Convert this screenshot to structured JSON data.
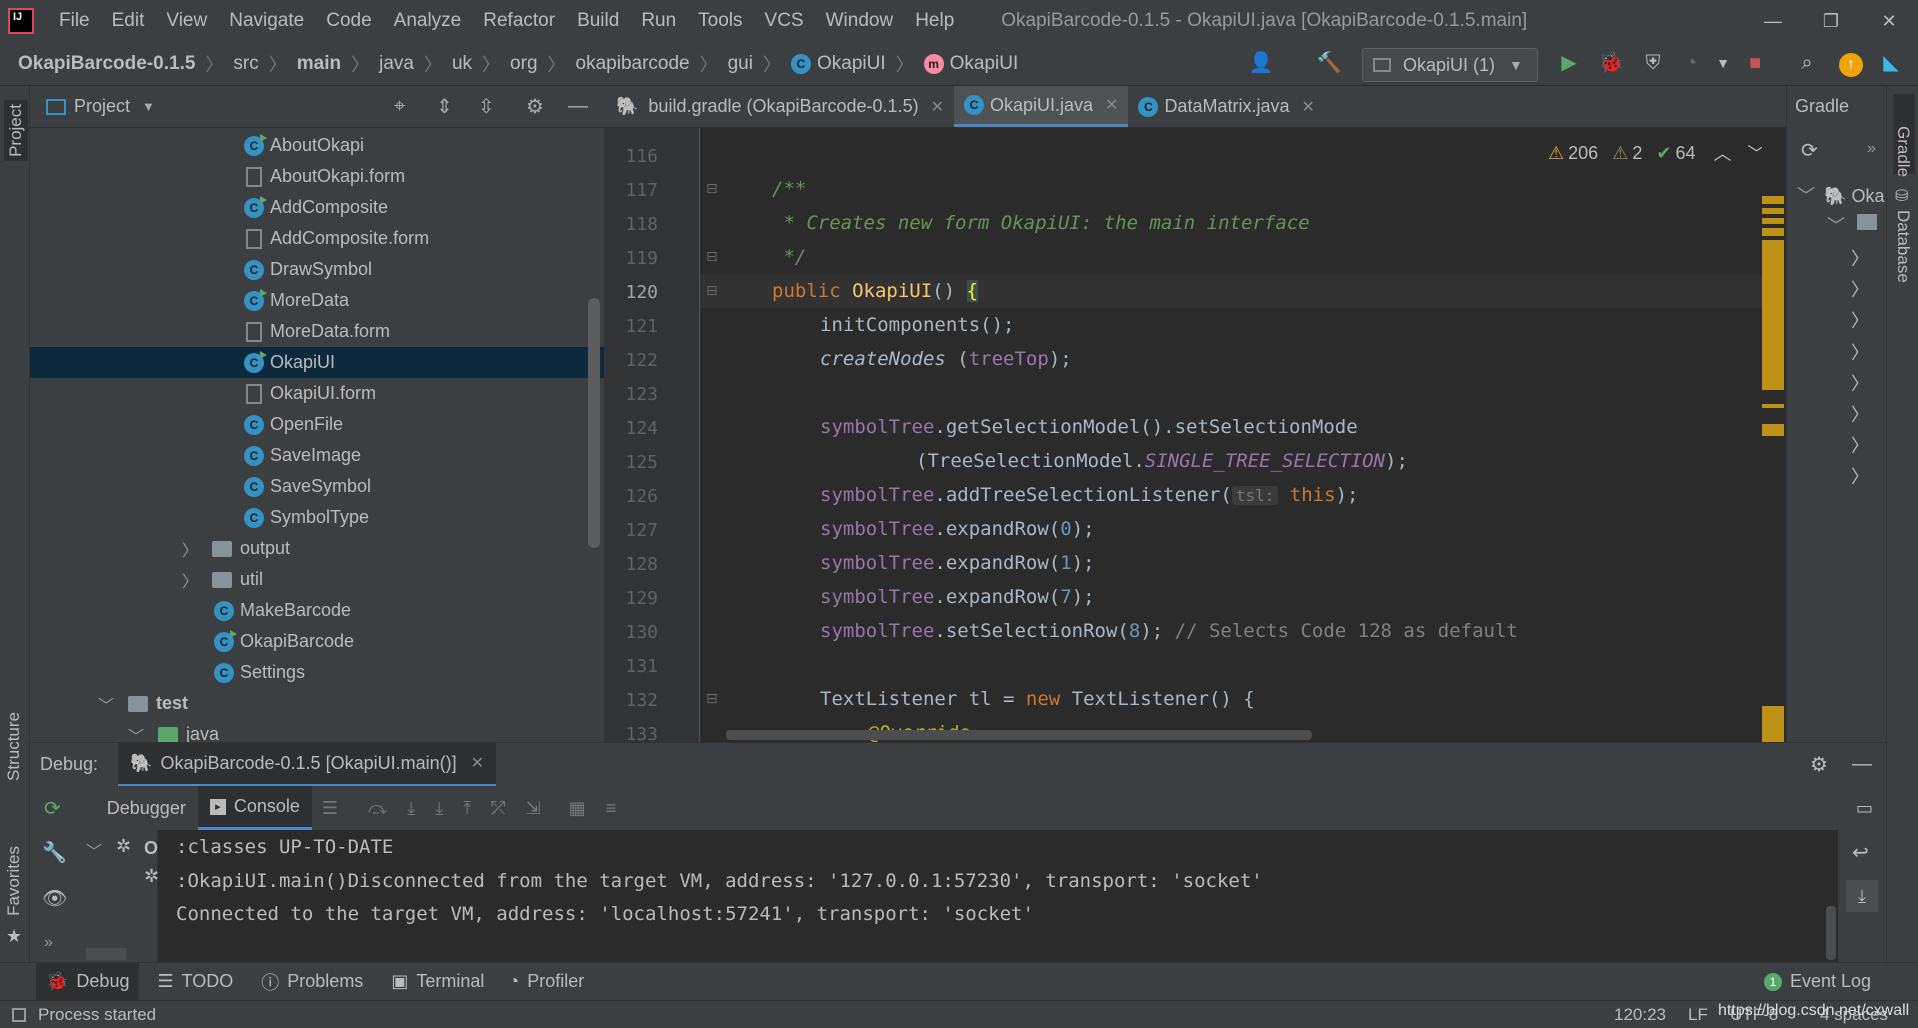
{
  "app": {
    "window_title": "OkapiBarcode-0.1.5 - OkapiUI.java [OkapiBarcode-0.1.5.main]",
    "menu": [
      "File",
      "Edit",
      "View",
      "Navigate",
      "Code",
      "Analyze",
      "Refactor",
      "Build",
      "Run",
      "Tools",
      "VCS",
      "Window",
      "Help"
    ]
  },
  "breadcrumb": {
    "project": "OkapiBarcode-0.1.5",
    "parts": [
      "src",
      "main",
      "java",
      "uk",
      "org",
      "okapibarcode",
      "gui"
    ],
    "class_name": "OkapiUI",
    "method_name": "OkapiUI"
  },
  "toolbar": {
    "run_config": "OkapiUI (1)"
  },
  "project_panel": {
    "title": "Project",
    "items": [
      {
        "label": "AboutOkapi",
        "kind": "class-run"
      },
      {
        "label": "AboutOkapi.form",
        "kind": "form"
      },
      {
        "label": "AddComposite",
        "kind": "class-run"
      },
      {
        "label": "AddComposite.form",
        "kind": "form"
      },
      {
        "label": "DrawSymbol",
        "kind": "class"
      },
      {
        "label": "MoreData",
        "kind": "class-run"
      },
      {
        "label": "MoreData.form",
        "kind": "form"
      },
      {
        "label": "OkapiUI",
        "kind": "class-run"
      },
      {
        "label": "OkapiUI.form",
        "kind": "form"
      },
      {
        "label": "OpenFile",
        "kind": "class"
      },
      {
        "label": "SaveImage",
        "kind": "class"
      },
      {
        "label": "SaveSymbol",
        "kind": "class"
      },
      {
        "label": "SymbolType",
        "kind": "class"
      },
      {
        "label": "output",
        "kind": "folder"
      },
      {
        "label": "util",
        "kind": "folder"
      },
      {
        "label": "MakeBarcode",
        "kind": "class"
      },
      {
        "label": "OkapiBarcode",
        "kind": "class-run"
      },
      {
        "label": "Settings",
        "kind": "class"
      },
      {
        "label": "test",
        "kind": "folder-open"
      },
      {
        "label": "java",
        "kind": "folder-open"
      }
    ]
  },
  "editor_tabs": [
    {
      "label": "build.gradle (OkapiBarcode-0.1.5)",
      "active": false
    },
    {
      "label": "OkapiUI.java",
      "active": true
    },
    {
      "label": "DataMatrix.java",
      "active": false
    }
  ],
  "inspections": {
    "warnings": "206",
    "weak_warnings": "2",
    "ok": "64"
  },
  "code": {
    "line_numbers": [
      "116",
      "117",
      "118",
      "119",
      "120",
      "121",
      "122",
      "123",
      "124",
      "125",
      "126",
      "127",
      "128",
      "129",
      "130",
      "131",
      "132",
      "133"
    ],
    "current_line": "120",
    "l117": "/**",
    "l118": " * Creates new form OkapiUI: the main interface",
    "l119": " */",
    "l120_kw": "public",
    "l120_name": "OkapiUI",
    "l120_rest": "()",
    "l120_brace": "{",
    "l121_name": "initComponents",
    "l121_rest": "();",
    "l122_name": "createNodes",
    "l122_open": " (",
    "l122_arg": "treeTop",
    "l122_close": ");",
    "l124_field": "symbolTree",
    "l124_rest": ".getSelectionModel().setSelectionMode",
    "l125_open": "(TreeSelectionModel.",
    "l125_const": "SINGLE_TREE_SELECTION",
    "l125_close": ");",
    "l126_field": "symbolTree",
    "l126_rest": ".addTreeSelectionListener(",
    "l126_hint": "tsl:",
    "l126_this": "this",
    "l126_close": ");",
    "l127_field": "symbolTree",
    "l127_rest": ".expandRow(",
    "l127_num": "0",
    "l127_close": ");",
    "l128_field": "symbolTree",
    "l128_rest": ".expandRow(",
    "l128_num": "1",
    "l128_close": ");",
    "l129_field": "symbolTree",
    "l129_rest": ".expandRow(",
    "l129_num": "7",
    "l129_close": ");",
    "l130_field": "symbolTree",
    "l130_rest": ".setSelectionRow(",
    "l130_num": "8",
    "l130_close": ");",
    "l130_comment": "// Selects Code 128 as default",
    "l132_a": "TextListener tl = ",
    "l132_kw": "new",
    "l132_b": " TextListener() {",
    "l133_ann": "@Override"
  },
  "gradle_panel": {
    "title": "Gradle",
    "root": "Oka"
  },
  "right_stripe": {
    "gradle": "Gradle",
    "database": "Database"
  },
  "left_stripe": {
    "project": "Project",
    "structure": "Structure",
    "favorites": "Favorites"
  },
  "debug": {
    "label": "Debug:",
    "session": "OkapiBarcode-0.1.5 [OkapiUI.main()]",
    "tabs": {
      "debugger": "Debugger",
      "console": "Console"
    },
    "frame_label": "O",
    "console_lines": [
      ":classes UP-TO-DATE",
      ":OkapiUI.main()Disconnected from the target VM, address: '127.0.0.1:57230', transport: 'socket'",
      "Connected to the target VM, address: 'localhost:57241', transport: 'socket'"
    ]
  },
  "tool_windows": {
    "debug": "Debug",
    "todo": "TODO",
    "problems": "Problems",
    "terminal": "Terminal",
    "profiler": "Profiler",
    "event_log": "Event Log",
    "event_log_count": "1"
  },
  "status": {
    "message": "Process started",
    "position": "120:23",
    "line_sep": "LF",
    "encoding": "UTF-8",
    "indent": "4 spaces",
    "watermark": "https://blog.csdn.net/cxwall"
  },
  "colors": {
    "accent": "#4a88c7",
    "warning": "#be9117",
    "run_green": "#59a869",
    "stop_red": "#c75450"
  }
}
